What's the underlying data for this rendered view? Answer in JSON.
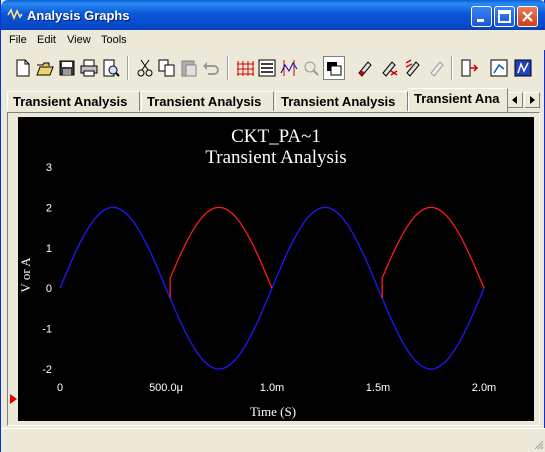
{
  "window": {
    "title": "Analysis Graphs"
  },
  "menu": [
    "File",
    "Edit",
    "View",
    "Tools"
  ],
  "toolbar": {
    "buttons": [
      "new-icon",
      "open-icon",
      "save-icon",
      "print-icon",
      "print-preview-icon",
      "cut-icon",
      "copy-icon",
      "paste-icon",
      "undo-icon",
      "grid-icon",
      "legend-icon",
      "cursors-icon",
      "zoom-icon",
      "reverse-colors-icon",
      "properties-icon",
      "select-marks-icon",
      "overlay-traces-icon",
      "restore-icon",
      "export-icon",
      "export-excel-icon",
      "export-mathcad-icon"
    ]
  },
  "tabs": [
    "Transient Analysis",
    "Transient Analysis",
    "Transient Analysis",
    "Transient Ana"
  ],
  "colors": {
    "plot_bg": "#000000",
    "trace_blue": "#1a1aff",
    "trace_red": "#ff1a1a",
    "text": "#ffffff"
  },
  "chart_data": {
    "type": "line",
    "title": "CKT_PA~1",
    "subtitle": "Transient Analysis",
    "xlabel": "Time (S)",
    "ylabel": "V or A",
    "xlim": [
      0,
      0.002
    ],
    "ylim": [
      -2,
      3
    ],
    "xticks": [
      "0",
      "500.0μ",
      "1.0m",
      "1.5m",
      "2.0m"
    ],
    "yticks": [
      "3",
      "2",
      "1",
      "0",
      "-1",
      "-2"
    ],
    "series": [
      {
        "color": "#1a1aff",
        "function": "2*sin(2*pi*1000*t)",
        "x_range": [
          0,
          0.002
        ]
      },
      {
        "color": "#ff1a1a",
        "function": "abs(2*sin(2*pi*1000*t))",
        "x_range": [
          0.00052,
          0.001
        ]
      },
      {
        "color": "#ff1a1a",
        "function": "abs(2*sin(2*pi*1000*t))",
        "x_range": [
          0.00152,
          0.002
        ]
      }
    ]
  }
}
